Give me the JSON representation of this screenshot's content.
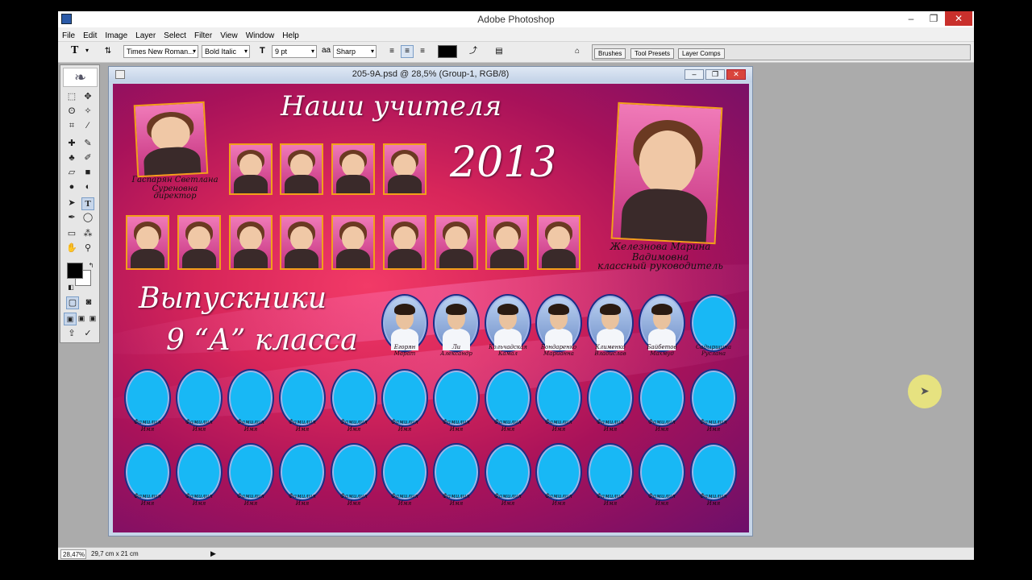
{
  "app": {
    "title": "Adobe Photoshop",
    "window_buttons": {
      "minimize": "–",
      "maximize": "❐",
      "close": "✕"
    }
  },
  "menu": [
    "File",
    "Edit",
    "Image",
    "Layer",
    "Select",
    "Filter",
    "View",
    "Window",
    "Help"
  ],
  "options_bar": {
    "tool_glyph": "T",
    "font_family": "Times New Roman...",
    "font_style": "Bold Italic",
    "font_size": "9 pt",
    "antialias_label": "aa",
    "antialias": "Sharp",
    "color": "#000000",
    "palette_tabs": [
      "Brushes",
      "Tool Presets",
      "Layer Comps"
    ]
  },
  "document": {
    "title": "205-9A.psd @ 28,5% (Group-1, RGB/8)",
    "heading_teachers": "Наши учителя",
    "year": "2013",
    "heading_graduates_1": "Выпускники",
    "heading_graduates_2": "9 “А” класса",
    "director": {
      "name": "Гаспарян Светлана Суреновна",
      "role": "директор"
    },
    "class_teacher": {
      "name": "Железнова Марина Вадимовна",
      "role": "классный руководитель"
    },
    "graduates": [
      {
        "surname": "Егорян",
        "name": "Марат"
      },
      {
        "surname": "Ли",
        "name": "Александр"
      },
      {
        "surname": "Кольчадская",
        "name": "Камал"
      },
      {
        "surname": "Бондаренко",
        "name": "Марианна"
      },
      {
        "surname": "Клименко",
        "name": "Владислав"
      },
      {
        "surname": "Байбетов",
        "name": "Махмуд"
      },
      {
        "surname": "Садыршина",
        "name": "Руслана"
      }
    ],
    "placeholder_label": {
      "surname": "Фамилия",
      "name": "Имя"
    }
  },
  "status": {
    "zoom": "28,47%",
    "doc_size": "29,7 cm x 21 cm",
    "arrow": "▶"
  },
  "colors": {
    "accent_close": "#c9302c",
    "oval_fill": "#18b8f5",
    "frame_gold": "#f2a01a"
  }
}
